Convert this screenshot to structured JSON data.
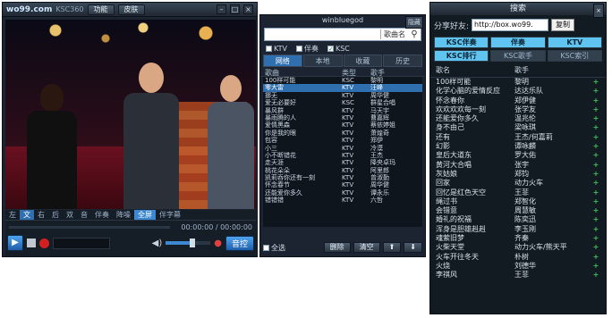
{
  "player": {
    "logo": "wo99.com",
    "wm_title": "KSC360",
    "btn_function": "功能",
    "btn_skin": "皮肤",
    "subtabs": [
      "左",
      "文",
      "右",
      "后",
      "双",
      "音",
      "伴奏",
      "降噪",
      "全屏",
      "伴字幕"
    ],
    "time": "00:00:00 / 00:00:00",
    "btn_record": "音控",
    "volume": 0.6
  },
  "song_panel": {
    "user": "winbluegod",
    "close_label": "隐藏",
    "search_placeholder": "",
    "search_mode": "歌曲名",
    "checks": [
      {
        "label": "KTV",
        "checked": false
      },
      {
        "label": "伴奏",
        "checked": false
      },
      {
        "label": "KSC",
        "checked": true
      }
    ],
    "tabs": [
      "网络",
      "本地",
      "收藏",
      "历史"
    ],
    "columns": [
      "歌曲",
      "类型",
      "歌手"
    ],
    "songs": [
      [
        "100样可能",
        "KSC",
        "黎明"
      ],
      [
        "零大雷",
        "KTV",
        "汪峰"
      ],
      [
        "挪无",
        "KTV",
        "周华健"
      ],
      [
        "爱无必要好",
        "KSC",
        "群星合唱"
      ],
      [
        "暴风群",
        "KTV",
        "马天宇"
      ],
      [
        "暴雨腾的人",
        "KTV",
        "曹嘉辉"
      ],
      [
        "爱情黑森",
        "KTV",
        "蔡依婷姐"
      ],
      [
        "你是我的眼",
        "KTV",
        "萧煌奇"
      ],
      [
        "包容",
        "KTV",
        "郑伊"
      ],
      [
        "小三",
        "KTV",
        "冷漠"
      ],
      [
        "小不断错花",
        "KTV",
        "王杰"
      ],
      [
        "走天涯",
        "KTV",
        "降央卓玛"
      ],
      [
        "桃花朵朵",
        "KTV",
        "阿里郎"
      ],
      [
        "凯莉吞你还有一刻",
        "KTV",
        "曾淑勤"
      ],
      [
        "怀念春节",
        "KTV",
        "周华健"
      ],
      [
        "还能爱你多久",
        "KTV",
        "谭永乐"
      ],
      [
        "错错错",
        "KTV",
        "六哲"
      ]
    ],
    "select_all": "全选",
    "btn_delete": "删除",
    "btn_clear": "清空"
  },
  "search_panel": {
    "title": "搜索",
    "share_label": "分享好友:",
    "share_url": "http://box.wo99.",
    "btn_copy": "复制",
    "filters": [
      {
        "label": "KSC伴奏",
        "on": true
      },
      {
        "label": "伴奏",
        "on": true
      },
      {
        "label": "KTV",
        "on": true
      },
      {
        "label": "KSC排行",
        "on": true
      },
      {
        "label": "KSC歌手",
        "on": false
      },
      {
        "label": "KSC索引",
        "on": false
      }
    ],
    "columns": [
      "歌名",
      "歌手"
    ],
    "results": [
      [
        "100样可能",
        "黎明"
      ],
      [
        "化学心脑的爱情反应",
        "达达乐队"
      ],
      [
        "怀念春你",
        "郑伊健"
      ],
      [
        "欢欢欢欢每一刻",
        "张学友"
      ],
      [
        "还能爱你多久",
        "温兆伦"
      ],
      [
        "身不由己",
        "梁咏琪"
      ],
      [
        "还有",
        "王杰/何嘉莉"
      ],
      [
        "幻影",
        "谭咏麟"
      ],
      [
        "皇后大道东",
        "罗大佑"
      ],
      [
        "黄河大合唱",
        "张宇"
      ],
      [
        "灰姑娘",
        "郑钧"
      ],
      [
        "回家",
        "动力火车"
      ],
      [
        "回忆是红色天空",
        "王菲"
      ],
      [
        "绳过书",
        "郑智化"
      ],
      [
        "会错意",
        "周慧敏"
      ],
      [
        "婚礼的祝福",
        "陈奕迅"
      ],
      [
        "浑身是胆雄赳赳",
        "李玉刚"
      ],
      [
        "魂萦旧梦",
        "齐秦"
      ],
      [
        "火柴天堂",
        "动力火车/熊天平"
      ],
      [
        "火车开往冬天",
        "朴树"
      ],
      [
        "火烧",
        "刘德华"
      ],
      [
        "李祺风",
        "王菲"
      ]
    ]
  }
}
